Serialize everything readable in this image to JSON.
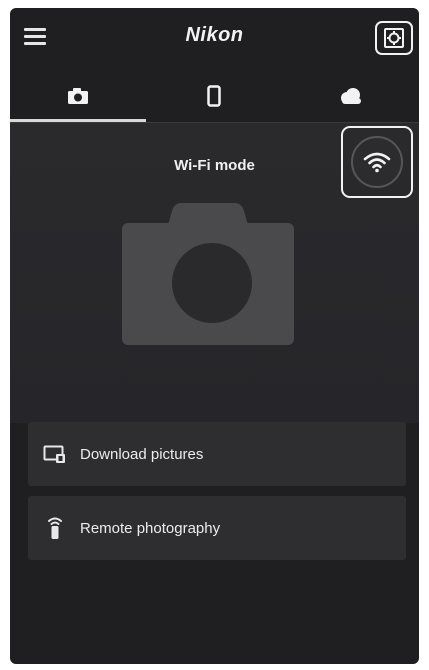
{
  "header": {
    "menu_icon": "menu-icon",
    "brand": "Nikon",
    "settings_icon": "gear-icon"
  },
  "tabs": [
    {
      "id": "camera",
      "icon": "camera-icon",
      "active": true
    },
    {
      "id": "smart-device",
      "icon": "smartphone-icon",
      "active": false
    },
    {
      "id": "cloud",
      "icon": "cloud-icon",
      "active": false
    }
  ],
  "main": {
    "mode_label": "Wi-Fi mode",
    "wifi_icon": "wifi-icon",
    "camera_graphic": "camera-icon"
  },
  "actions": [
    {
      "id": "download",
      "label": "Download pictures",
      "icon": "download-pictures-icon"
    },
    {
      "id": "remote",
      "label": "Remote photography",
      "icon": "remote-photography-icon"
    }
  ],
  "colors": {
    "background": "#1f1f21",
    "panel": "#2e2e31",
    "text": "#ececec",
    "highlight_frame": "#f2f2f2"
  }
}
